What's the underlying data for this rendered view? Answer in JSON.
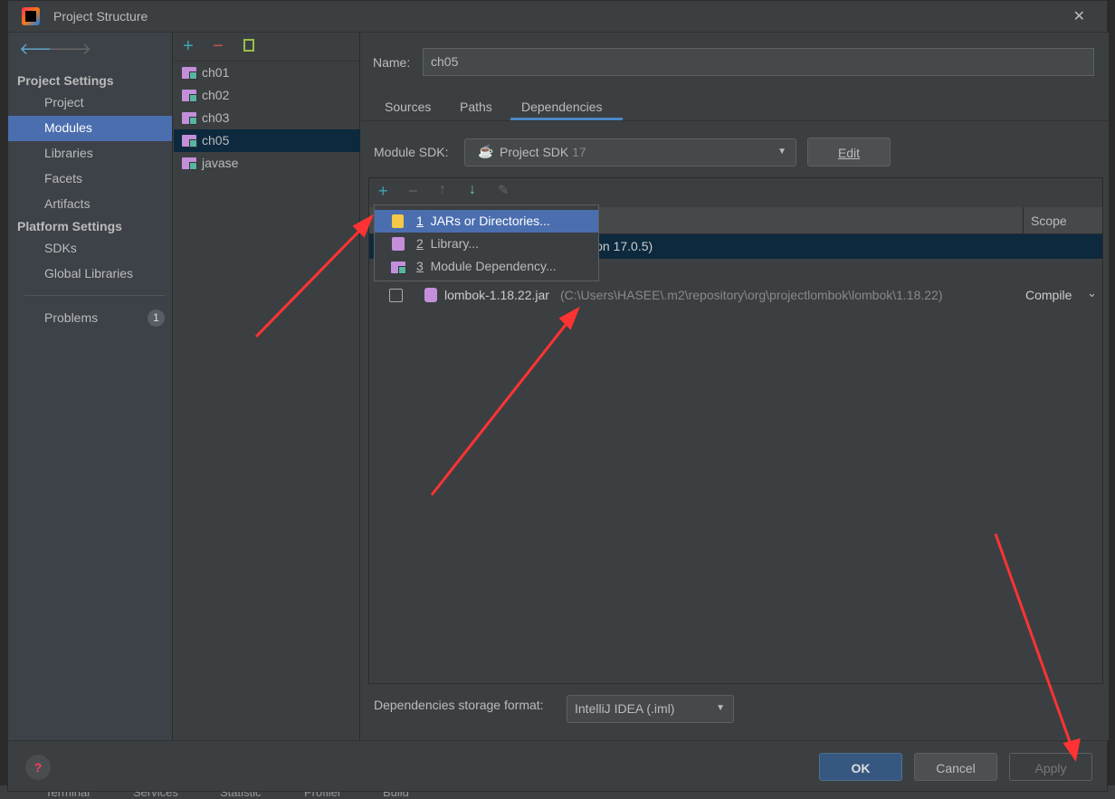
{
  "window": {
    "title": "Project Structure",
    "close": "✕"
  },
  "sidebar": {
    "project_settings": "Project Settings",
    "platform_settings": "Platform Settings",
    "items": [
      {
        "label": "Project"
      },
      {
        "label": "Modules"
      },
      {
        "label": "Libraries"
      },
      {
        "label": "Facets"
      },
      {
        "label": "Artifacts"
      },
      {
        "label": "SDKs"
      },
      {
        "label": "Global Libraries"
      },
      {
        "label": "Problems",
        "badge": "1"
      }
    ]
  },
  "modules": [
    "ch01",
    "ch02",
    "ch03",
    "ch05",
    "javase"
  ],
  "module": {
    "name_label": "Name:",
    "name": "ch05",
    "tabs": [
      "Sources",
      "Paths",
      "Dependencies"
    ],
    "active_tab": "Dependencies",
    "sdk_label": "Module SDK:",
    "sdk_value": "Project SDK",
    "sdk_version": "17",
    "edit": "Edit",
    "scope_header": "Scope",
    "sdk_row": "sion 17.0.5)",
    "dep": {
      "name": "lombok-1.18.22.jar",
      "path": "(C:\\Users\\HASEE\\.m2\\repository\\org\\projectlombok\\lombok\\1.18.22)",
      "scope": "Compile"
    },
    "storage_label": "Dependencies storage format:",
    "storage_value": "IntelliJ IDEA (.iml)"
  },
  "popup": [
    {
      "num": "1",
      "label": "JARs or Directories..."
    },
    {
      "num": "2",
      "label": "Library..."
    },
    {
      "num": "3",
      "label": "Module Dependency..."
    }
  ],
  "buttons": {
    "ok": "OK",
    "cancel": "Cancel",
    "apply": "Apply"
  },
  "background_toolbar": [
    "Terminal",
    "Services",
    "Statistic",
    "Profiler",
    "Build"
  ],
  "colors": {
    "selection": "#4b6eaf",
    "accent_add": "#3ca6b4",
    "remove": "#c75450",
    "annotation": "#ff3333"
  }
}
